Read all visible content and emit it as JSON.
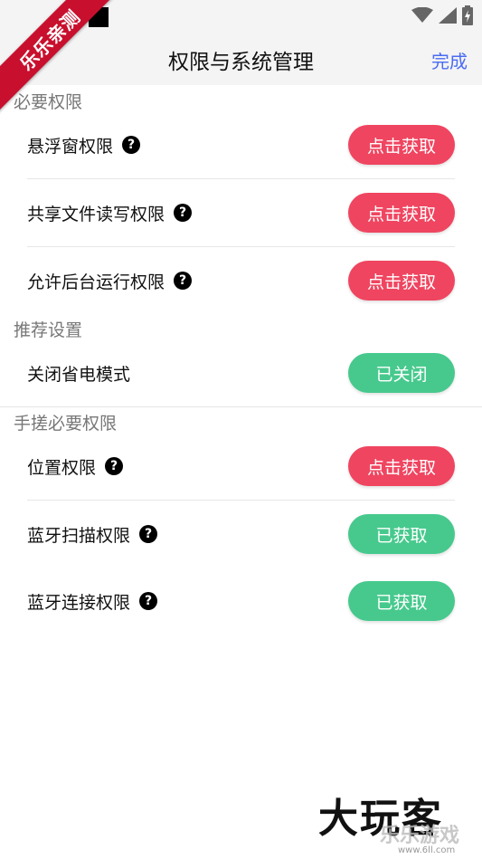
{
  "status_bar": {
    "icons": [
      "small-square-icon",
      "black-square-icon",
      "wifi-icon",
      "signal-icon",
      "battery-charging-icon"
    ]
  },
  "ribbon": {
    "text": "乐乐亲测"
  },
  "header": {
    "title": "权限与系统管理",
    "done": "完成"
  },
  "sections": [
    {
      "title": "必要权限",
      "items": [
        {
          "label": "悬浮窗权限",
          "help": "?",
          "button": "点击获取",
          "state": "red"
        },
        {
          "label": "共享文件读写权限",
          "help": "?",
          "button": "点击获取",
          "state": "red"
        },
        {
          "label": "允许后台运行权限",
          "help": "?",
          "button": "点击获取",
          "state": "red"
        }
      ]
    },
    {
      "title": "推荐设置",
      "items": [
        {
          "label": "关闭省电模式",
          "button": "已关闭",
          "state": "green"
        }
      ]
    },
    {
      "title": "手搓必要权限",
      "items": [
        {
          "label": "位置权限",
          "help": "?",
          "button": "点击获取",
          "state": "red"
        },
        {
          "label": "蓝牙扫描权限",
          "help": "?",
          "button": "已获取",
          "state": "green"
        },
        {
          "label": "蓝牙连接权限",
          "help": "?",
          "button": "已获取",
          "state": "green"
        }
      ]
    }
  ],
  "colors": {
    "red": "#ef4560",
    "green": "#47c98d",
    "accent": "#4a6cf2"
  },
  "watermark": {
    "main": "大玩客",
    "sub": "乐乐游戏",
    "url": "www.6ll.com"
  }
}
